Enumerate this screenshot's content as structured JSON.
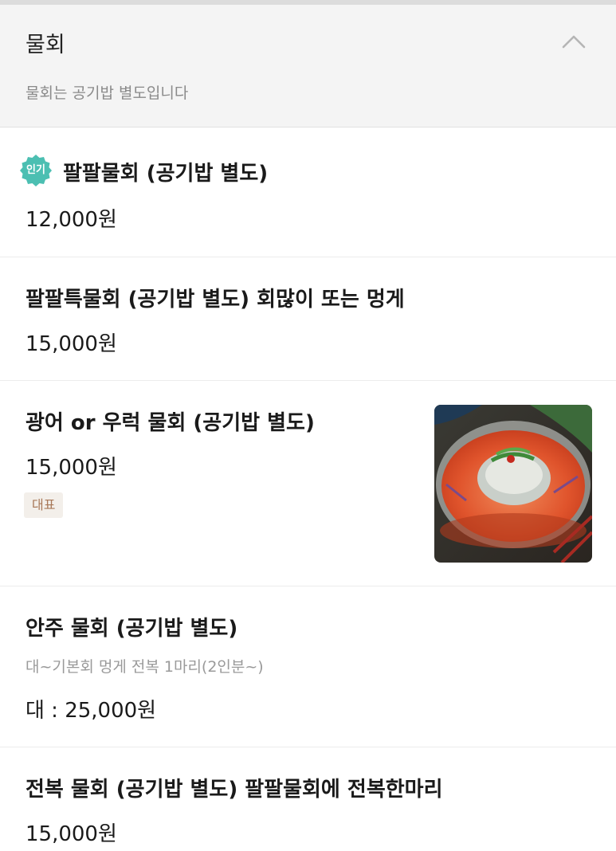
{
  "category": {
    "title": "물회",
    "description": "물회는 공기밥 별도입니다",
    "toggle_icon": "chevron-up-icon"
  },
  "items": [
    {
      "badge": "인기",
      "name": "팔팔물회 (공기밥 별도)",
      "price": "12,000원"
    },
    {
      "name": "팔팔특물회 (공기밥 별도)  회많이 또는 멍게",
      "price": "15,000원"
    },
    {
      "name": "광어 or 우럭 물회 (공기밥 별도)",
      "price": "15,000원",
      "tag": "대표",
      "image": "mulhoe-photo"
    },
    {
      "name": "안주 물회 (공기밥 별도)",
      "description": "대~기본회 멍게 전복 1마리(2인분~)",
      "price": "대 : 25,000원"
    },
    {
      "name": "전복 물회 (공기밥 별도)  팔팔물회에 전복한마리",
      "price": "15,000원"
    }
  ],
  "colors": {
    "badge": "#4cbfb2",
    "tag_bg": "#f3efea",
    "tag_text": "#a87858",
    "header_bg": "#f4f4f4"
  }
}
